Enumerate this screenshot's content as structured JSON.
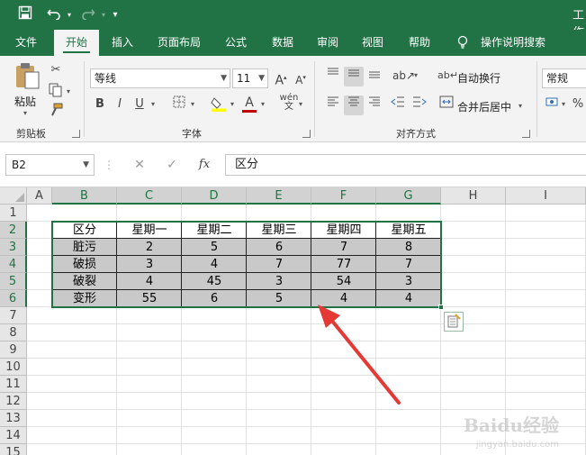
{
  "titlebar": {
    "title": "工作",
    "save_icon": "save-icon",
    "undo_icon": "undo-icon",
    "redo_icon": "redo-icon",
    "customize_icon": "customize-qat-icon"
  },
  "menubar": {
    "tabs": [
      {
        "label": "文件"
      },
      {
        "label": "开始"
      },
      {
        "label": "插入"
      },
      {
        "label": "页面布局"
      },
      {
        "label": "公式"
      },
      {
        "label": "数据"
      },
      {
        "label": "审阅"
      },
      {
        "label": "视图"
      },
      {
        "label": "帮助"
      },
      {
        "label": "操作说明搜索"
      }
    ],
    "active_tab": "开始",
    "accent": "#217346"
  },
  "ribbon": {
    "clipboard": {
      "paste_label": "粘贴",
      "group_label": "剪贴板"
    },
    "font": {
      "font_name": "等线",
      "font_size": "11",
      "bold": "B",
      "italic": "I",
      "underline": "U",
      "font_color_glyph": "A",
      "group_label": "字体",
      "highlight_color": "#ffff00",
      "font_color": "#c00000"
    },
    "alignment": {
      "wrap_text": "自动换行",
      "merge_center": "合并后居中",
      "group_label": "对齐方式"
    },
    "number": {
      "format": "常规"
    }
  },
  "formula_bar": {
    "name_box": "B2",
    "fx": "fx",
    "content": "区分"
  },
  "sheet": {
    "columns": [
      "A",
      "B",
      "C",
      "D",
      "E",
      "F",
      "G",
      "H",
      "I"
    ],
    "rows": [
      "1",
      "2",
      "3",
      "4",
      "5",
      "6",
      "7",
      "8",
      "9",
      "10",
      "11",
      "12",
      "13",
      "14",
      "15"
    ],
    "table": {
      "header": [
        "区分",
        "星期一",
        "星期二",
        "星期三",
        "星期四",
        "星期五"
      ],
      "data": [
        [
          "脏污",
          "2",
          "5",
          "6",
          "7",
          "8"
        ],
        [
          "破损",
          "3",
          "4",
          "7",
          "77",
          "7"
        ],
        [
          "破裂",
          "4",
          "45",
          "3",
          "54",
          "3"
        ],
        [
          "变形",
          "55",
          "6",
          "5",
          "4",
          "4"
        ]
      ],
      "fill_color": "#c9c9c9",
      "selection_color": "#217346"
    }
  },
  "annotation": {
    "arrow_color": "#e53935"
  },
  "watermark": {
    "text": "Baidu经验",
    "sub": "jingyan.baidu.com"
  }
}
